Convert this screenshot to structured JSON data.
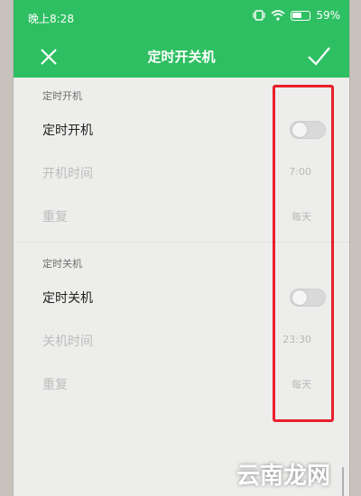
{
  "status_bar": {
    "time": "晚上8:28",
    "battery": "59%",
    "icons": [
      "vibrate-icon",
      "wifi-icon",
      "battery-icon"
    ]
  },
  "toolbar": {
    "title": "定时开关机",
    "close_icon": "close-icon",
    "confirm_icon": "check-icon"
  },
  "power_on": {
    "section_title": "定时开机",
    "toggle_label": "定时开机",
    "toggle_on": false,
    "time_label": "开机时间",
    "time_value": "7:00",
    "repeat_label": "重复",
    "repeat_value": "每天"
  },
  "power_off": {
    "section_title": "定时关机",
    "toggle_label": "定时关机",
    "toggle_on": false,
    "time_label": "关机时间",
    "time_value": "23:30",
    "repeat_label": "重复",
    "repeat_value": "每天"
  },
  "watermark": "云南龙网",
  "colors": {
    "accent": "#2fbf63",
    "highlight": "#e8202a"
  }
}
